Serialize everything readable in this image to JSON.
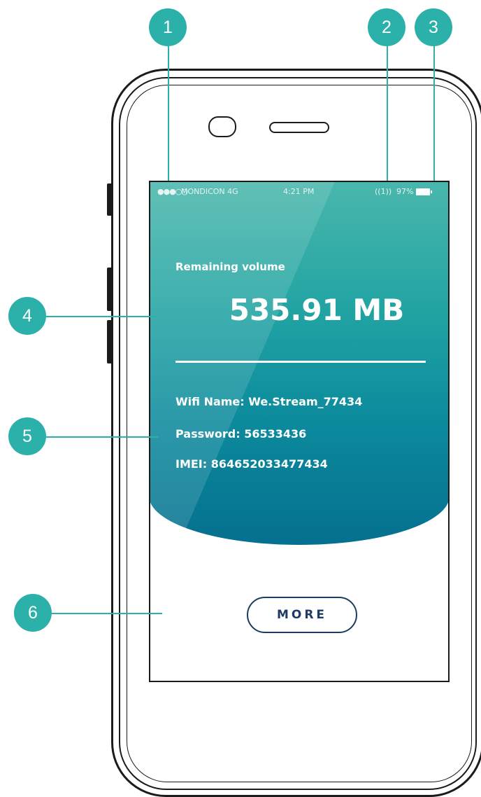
{
  "statusbar": {
    "signal": "●●●○○",
    "carrier": "MONDICON 4G",
    "time": "4:21 PM",
    "radio": "((1))",
    "battery_pct": "97%"
  },
  "main": {
    "remaining_label": "Remaining volume",
    "remaining_value": "535.91 MB",
    "wifi_line": "Wifi Name: We.Stream_77434",
    "password_line": "Password: 56533436",
    "imei_line": "IMEI: 864652033477434",
    "more_label": "MORE"
  },
  "callouts": [
    "1",
    "2",
    "3",
    "4",
    "5",
    "6"
  ],
  "colors": {
    "accent": "#2bb1aa",
    "hero_top": "#4ab7ac",
    "hero_bottom": "#05708f",
    "button_text": "#1f3b63"
  }
}
